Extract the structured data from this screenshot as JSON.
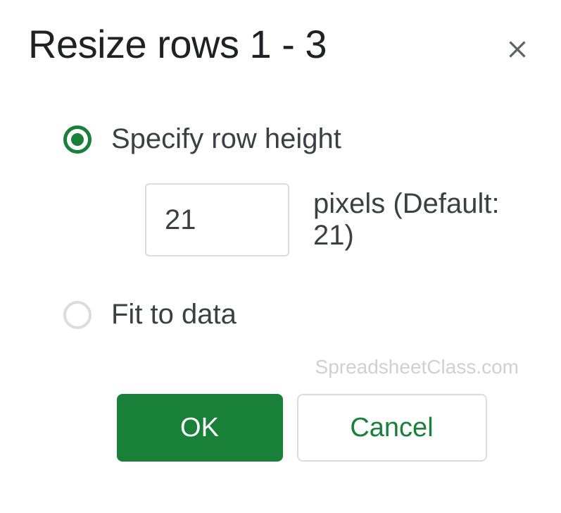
{
  "dialog": {
    "title": "Resize rows 1 - 3",
    "options": {
      "specify": {
        "label": "Specify row height",
        "selected": true,
        "input_value": "21",
        "suffix": "pixels (Default: 21)"
      },
      "fit": {
        "label": "Fit to data",
        "selected": false
      }
    },
    "buttons": {
      "ok": "OK",
      "cancel": "Cancel"
    }
  },
  "watermark": "SpreadsheetClass.com",
  "colors": {
    "accent": "#188038"
  }
}
